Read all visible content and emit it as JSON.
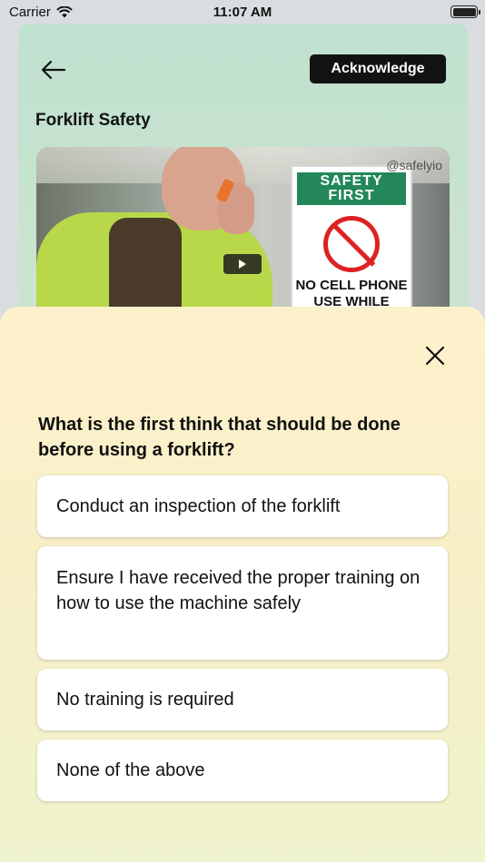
{
  "status_bar": {
    "carrier": "Carrier",
    "time": "11:07 AM"
  },
  "header": {
    "acknowledge_label": "Acknowledge",
    "title": "Forklift Safety"
  },
  "video": {
    "watermark": "@safelyio",
    "sign_header_line1": "SAFETY",
    "sign_header_line2": "FIRST",
    "sign_text_line1": "NO CELL PHONE",
    "sign_text_line2": "USE WHILE"
  },
  "quiz": {
    "question": "What is the first think that should be done before using a forklift?",
    "options": [
      {
        "label": "Conduct an inspection of the forklift"
      },
      {
        "label": "Ensure I have received the proper training on how to use the machine safely"
      },
      {
        "label": "No training is required"
      },
      {
        "label": "None of the above"
      }
    ]
  },
  "colors": {
    "accent_button": "#121212",
    "card_background": "#c9e3cf",
    "sheet_background": "#fbf0c9",
    "sign_green": "#23875a",
    "sign_red": "#dd2222"
  }
}
